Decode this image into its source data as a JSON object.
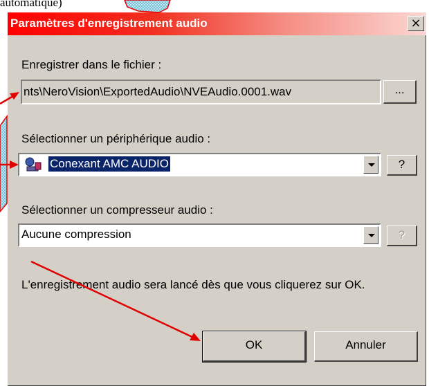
{
  "doc": {
    "text": "automatique)"
  },
  "dialog": {
    "title": "Paramètres d'enregistrement audio",
    "close_glyph": "×",
    "file_label": "Enregistrer dans le fichier :",
    "file_value": "nts\\NeroVision\\ExportedAudio\\NVEAudio.0001.wav",
    "browse_label": "...",
    "device_label": "Sélectionner un périphérique audio :",
    "device_value": "Conexant AMC AUDIO",
    "device_icon": "microphone-icon",
    "help_label": "?",
    "compressor_label": "Sélectionner un compresseur audio :",
    "compressor_value": "Aucune compression",
    "info_text": "L'enregistrement audio sera lancé dès que vous cliquerez sur OK.",
    "ok_label": "OK",
    "cancel_label": "Annuler"
  },
  "colors": {
    "title_start": "#ff0000",
    "title_end": "#fbd7d3",
    "annotation_arrow": "#e00000",
    "callout_fill": "#9ad7e8",
    "selection": "#0a246a"
  }
}
